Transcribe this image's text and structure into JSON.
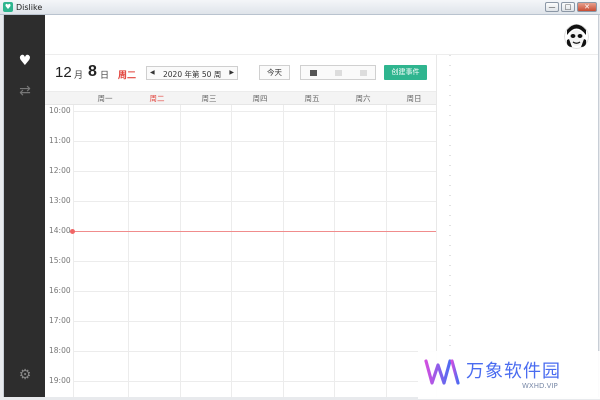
{
  "window": {
    "title": "Dislike",
    "min_glyph": "—",
    "max_glyph": "□",
    "close_glyph": "✕"
  },
  "calendar": {
    "month": "12",
    "month_suffix": "月",
    "day": "8",
    "day_suffix": "日",
    "weekday": "周二",
    "week_label": "2020 年第 50 周",
    "prev_glyph": "◀",
    "next_glyph": "▶",
    "today_label": "今天",
    "create_label": "创建事件",
    "days": [
      "周一",
      "周二",
      "周三",
      "周四",
      "周五",
      "周六",
      "周日"
    ],
    "current_day_index": 1,
    "times": [
      "10:00",
      "11:00",
      "12:00",
      "13:00",
      "14:00",
      "15:00",
      "16:00",
      "17:00",
      "18:00",
      "19:00"
    ],
    "now_time": "14:00"
  },
  "sidebar": {
    "icons": [
      "heart-icon",
      "sync-icon",
      "gear-icon"
    ]
  },
  "colors": {
    "accent": "#2fb58f",
    "today": "#f06565",
    "sidebar": "#2d2d2d"
  },
  "watermark": {
    "brand": "万象软件园",
    "url": "WXHD.VIP"
  }
}
